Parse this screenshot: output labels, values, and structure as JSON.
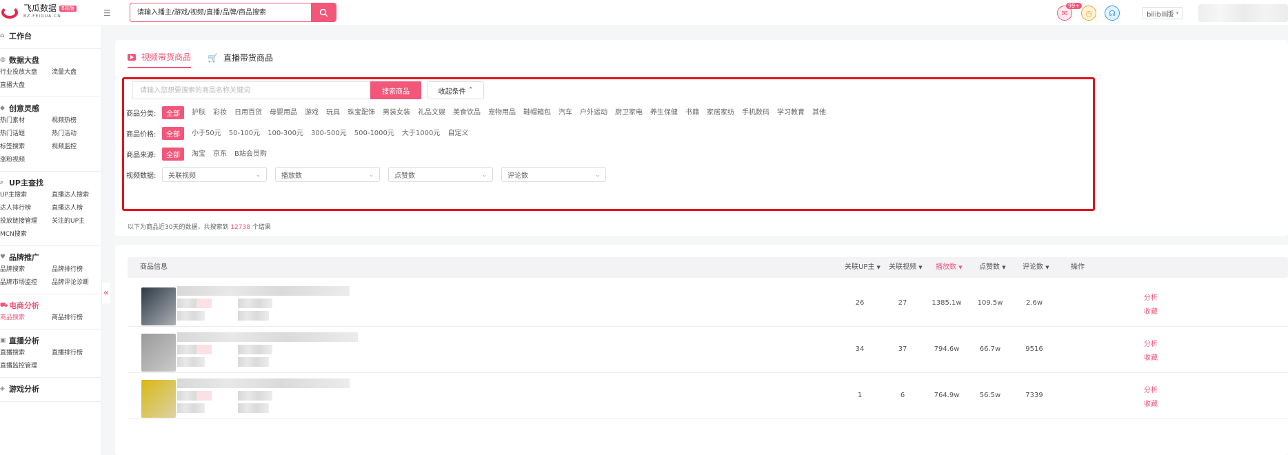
{
  "header": {
    "logo_title": "飞瓜数据",
    "logo_badge": "B站版",
    "logo_sub": "BZ.FEIGUA.CN",
    "search_placeholder": "请输入播主/游戏/视频/直播/品牌/商品搜索",
    "mail_badge": "99+",
    "platform": "bilibili版"
  },
  "sidebar": {
    "groups": [
      {
        "title": "工作台",
        "icon": "home-icon",
        "items": []
      },
      {
        "title": "数据大盘",
        "icon": "globe-icon",
        "items": [
          "行业投放大盘",
          "流量大盘",
          "直播大盘"
        ]
      },
      {
        "title": "创意灵感",
        "icon": "bulb-icon",
        "items": [
          "热门素材",
          "视频热榜",
          "热门话题",
          "热门活动",
          "标签搜索",
          "视频监控",
          "涨粉视频"
        ]
      },
      {
        "title": "UP主查找",
        "icon": "search-icon",
        "items": [
          "UP主搜索",
          "直播达人搜索",
          "达人排行榜",
          "直播达人榜",
          "投放链接管理",
          "关注的UP主",
          "MCN搜索"
        ]
      },
      {
        "title": "品牌推广",
        "icon": "heart-icon",
        "items": [
          "品牌搜索",
          "品牌排行榜",
          "品牌市场监控",
          "品牌评论诊断"
        ]
      },
      {
        "title": "电商分析",
        "icon": "cart-icon",
        "items": [
          "商品搜索",
          "商品排行榜"
        ]
      },
      {
        "title": "直播分析",
        "icon": "tv-icon",
        "items": [
          "直播搜索",
          "直播排行榜",
          "直播监控管理"
        ]
      },
      {
        "title": "游戏分析",
        "icon": "gamepad-icon",
        "items": []
      }
    ]
  },
  "tabs": [
    {
      "label": "视频带货商品",
      "icon": "video-icon"
    },
    {
      "label": "直播带货商品",
      "icon": "cart-icon"
    }
  ],
  "filters": {
    "keyword_placeholder": "请输入您想要搜索的商品名称关键词",
    "search_button": "搜索商品",
    "fold_button": "收起条件",
    "category_label": "商品分类:",
    "categories": [
      "全部",
      "护肤",
      "彩妆",
      "日用百货",
      "母婴用品",
      "游戏",
      "玩具",
      "珠宝配饰",
      "男装女装",
      "礼品文娱",
      "美食饮品",
      "宠物用品",
      "鞋帽箱包",
      "汽车",
      "户外运动",
      "厨卫家电",
      "养生保健",
      "书籍",
      "家居家纺",
      "手机数码",
      "学习教育",
      "其他"
    ],
    "price_label": "商品价格:",
    "prices": [
      "全部",
      "小于50元",
      "50-100元",
      "100-300元",
      "300-500元",
      "500-1000元",
      "大于1000元",
      "自定义"
    ],
    "source_label": "商品来源:",
    "sources": [
      "全部",
      "淘宝",
      "京东",
      "B站会员购"
    ],
    "video_label": "视频数据:",
    "video_dropdowns": [
      "关联视频",
      "播放数",
      "点赞数",
      "评论数"
    ]
  },
  "result": {
    "prefix": "以下为商品近30天的数据，共搜索到",
    "count": "12738",
    "suffix": "个结果"
  },
  "table": {
    "headers": [
      "商品信息",
      "关联UP主",
      "关联视频",
      "播放数",
      "点赞数",
      "评论数",
      "操作"
    ],
    "rows": [
      {
        "up": "26",
        "videos": "27",
        "plays": "1385.1w",
        "likes": "109.5w",
        "comments": "2.6w",
        "thumb_color": "#2d3a48"
      },
      {
        "up": "34",
        "videos": "37",
        "plays": "794.6w",
        "likes": "66.7w",
        "comments": "9516",
        "thumb_color": "#9a9a9a"
      },
      {
        "up": "1",
        "videos": "6",
        "plays": "764.9w",
        "likes": "56.5w",
        "comments": "7339",
        "thumb_color": "#d9b814"
      }
    ],
    "action_analyze": "分析",
    "action_favorite": "收藏"
  }
}
